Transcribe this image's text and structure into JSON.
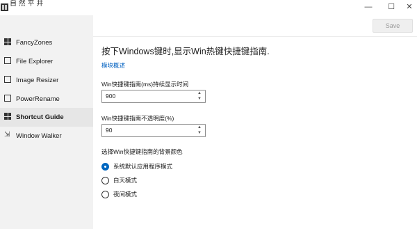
{
  "window": {
    "title": "自 然 平 井",
    "minimize_glyph": "—",
    "maximize_glyph": "☐",
    "close_glyph": "✕"
  },
  "sidebar": {
    "items": [
      {
        "label": "FancyZones",
        "icon": "fancyzones-grid-icon"
      },
      {
        "label": "File Explorer",
        "icon": "file-explorer-icon"
      },
      {
        "label": "Image Resizer",
        "icon": "image-resizer-icon"
      },
      {
        "label": "PowerRename",
        "icon": "power-rename-icon"
      },
      {
        "label": "Shortcut Guide",
        "icon": "shortcut-guide-icon",
        "active": true
      },
      {
        "label": "Window Walker",
        "icon": "window-walker-icon"
      }
    ]
  },
  "toolbar": {
    "save_label": "Save"
  },
  "main": {
    "heading": "按下Windows键时,显示Win热键快捷键指南.",
    "overview_link": "模块概述",
    "duration": {
      "label": "Win快捷键指南(ms)持续显示时间",
      "value": "900"
    },
    "opacity": {
      "label": "Win快捷键指南不透明度(%)",
      "value": "90"
    },
    "background": {
      "label": "选择Win快捷键指南的背景颜色",
      "options": [
        {
          "label": "系统默认应用程序模式",
          "checked": true
        },
        {
          "label": "白天模式",
          "checked": false
        },
        {
          "label": "夜间模式",
          "checked": false
        }
      ]
    }
  },
  "colors": {
    "accent": "#0067c0",
    "link": "#0060c0",
    "sidebar_bg": "#f2f2f2"
  }
}
